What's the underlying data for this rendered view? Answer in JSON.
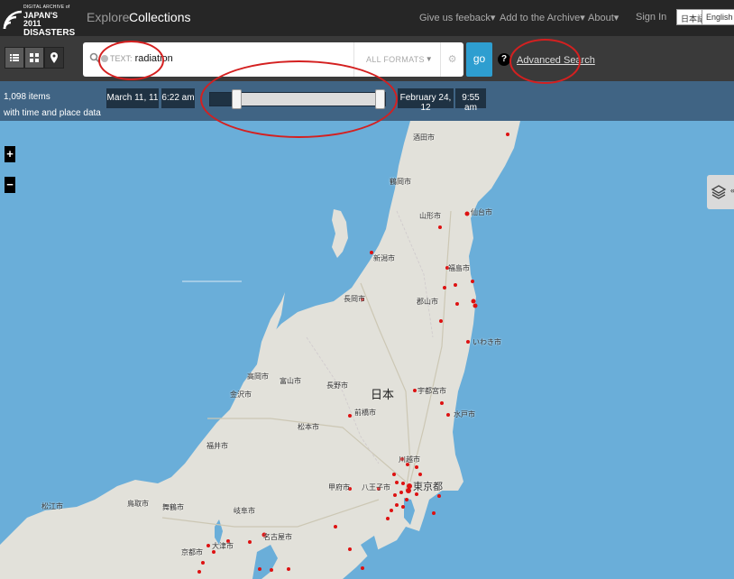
{
  "logo": {
    "line1": "DIGITAL ARCHIVE of",
    "line2": "JAPAN'S 2011",
    "line3": "DISASTERS"
  },
  "nav": {
    "explore": "Explore",
    "collections": "Collections",
    "feedback": "Give us feeback",
    "add": "Add to the Archive",
    "about": "About",
    "signin": "Sign In",
    "lang_ja": "日本語",
    "lang_en": "English",
    "dropdown_caret": "▾"
  },
  "search": {
    "token_key": "TEXT:",
    "token_value": "radiation",
    "formats": "ALL FORMATS",
    "go": "go",
    "help": "?",
    "advanced": "Advanced Search"
  },
  "timeline": {
    "count_line1": "1,098 items",
    "count_line2": "with time and place data",
    "start_date": "March 11, 11",
    "start_time": "6:22 am",
    "end_date": "February 24, 12",
    "end_time": "9:55 am",
    "range_start": 0.15,
    "range_end": 0.97
  },
  "map": {
    "zoom_in": "+",
    "zoom_out": "−",
    "country_label": "日本",
    "layer_chevron": "«",
    "colors": {
      "sea": "#6aaed9",
      "land": "#e2e1da",
      "marker": "#dd1111"
    },
    "cities": [
      "酒田市",
      "鶴岡市",
      "山形市",
      "仙台市",
      "新潟市",
      "福島市",
      "長岡市",
      "郡山市",
      "いわき市",
      "高岡市",
      "富山市",
      "金沢市",
      "長野市",
      "宇都宮市",
      "前橋市",
      "水戸市",
      "松本市",
      "福井市",
      "川越市",
      "甲府市",
      "八王子市",
      "東京都",
      "松江市",
      "鳥取市",
      "舞鶴市",
      "岐阜市",
      "名古屋市",
      "大津市",
      "京都市"
    ]
  }
}
